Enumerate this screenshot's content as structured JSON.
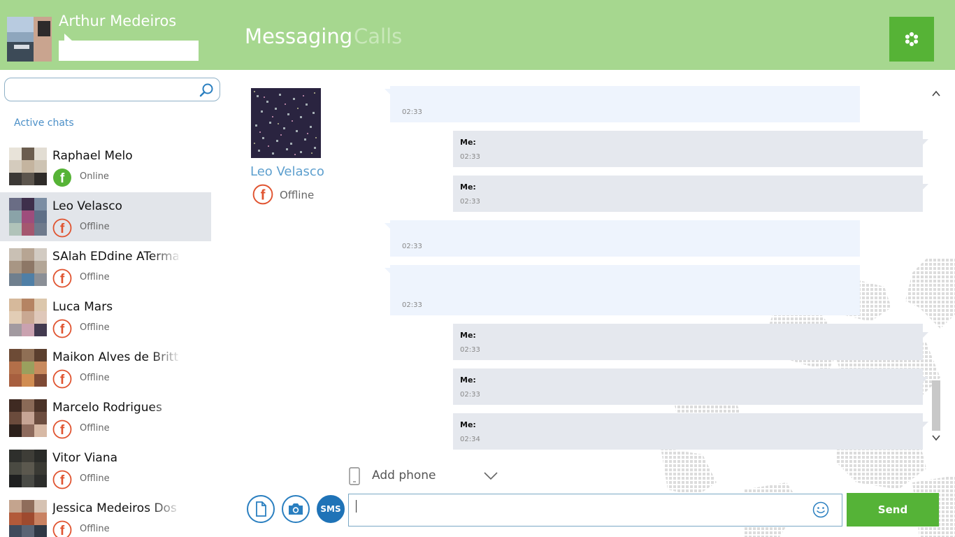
{
  "header": {
    "user_name": "Arthur Medeiros",
    "mood": "",
    "tabs": [
      {
        "label": "Messaging",
        "active": true
      },
      {
        "label": "Calls",
        "active": false
      }
    ],
    "settings_icon": "gear-icon"
  },
  "sidebar": {
    "search_placeholder": "",
    "section_label": "Active chats",
    "contacts": [
      {
        "name": "Raphael Melo",
        "status": "Online",
        "network": "facebook",
        "selected": false
      },
      {
        "name": "Leo Velasco",
        "status": "Offline",
        "network": "facebook",
        "selected": true
      },
      {
        "name": "SAlah EDdine ATermal",
        "status": "Offline",
        "network": "facebook",
        "selected": false
      },
      {
        "name": "Luca Mars",
        "status": "Offline",
        "network": "facebook",
        "selected": false
      },
      {
        "name": "Maikon Alves de Britto",
        "status": "Offline",
        "network": "facebook",
        "selected": false
      },
      {
        "name": "Marcelo Rodrigues",
        "status": "Offline",
        "network": "facebook",
        "selected": false
      },
      {
        "name": "Vitor Viana",
        "status": "Offline",
        "network": "facebook",
        "selected": false
      },
      {
        "name": "Jessica Medeiros Dos S",
        "status": "Offline",
        "network": "facebook",
        "selected": false
      }
    ]
  },
  "conversation": {
    "contact_name": "Leo Velasco",
    "contact_status": "Offline",
    "messages": [
      {
        "direction": "in",
        "sender": "",
        "time": "02:33"
      },
      {
        "direction": "out",
        "sender": "Me:",
        "time": "02:33"
      },
      {
        "direction": "out",
        "sender": "Me:",
        "time": "02:33"
      },
      {
        "direction": "in",
        "sender": "",
        "time": "02:33"
      },
      {
        "direction": "in",
        "sender": "",
        "time": "02:33"
      },
      {
        "direction": "out",
        "sender": "Me:",
        "time": "02:33"
      },
      {
        "direction": "out",
        "sender": "Me:",
        "time": "02:33"
      },
      {
        "direction": "out",
        "sender": "Me:",
        "time": "02:34"
      }
    ]
  },
  "composer": {
    "add_phone_label": "Add phone",
    "sms_label": "SMS",
    "input_value": "",
    "send_label": "Send"
  },
  "colors": {
    "header_bg": "#a6d78f",
    "accent_green": "#55b337",
    "accent_blue": "#2a7fc0",
    "facebook_offline": "#e0532f",
    "facebook_online": "#56b336",
    "selected_row": "#e2e5ea"
  }
}
